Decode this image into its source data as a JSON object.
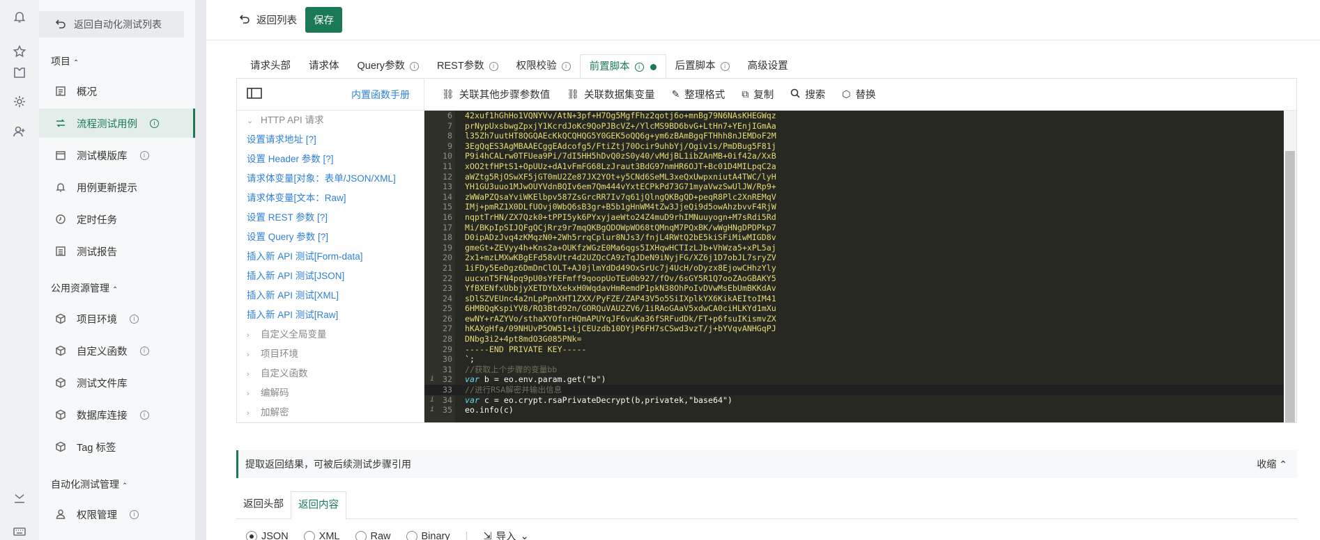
{
  "rail": {
    "icons": [
      "bell-icon",
      "star-icon",
      "shirt-icon",
      "gear-icon",
      "add-user-icon",
      "collapse-icon",
      "keyboard-icon"
    ]
  },
  "nav": {
    "back_label": "返回自动化测试列表",
    "group1": "项目",
    "group1_items": [
      {
        "label": "概况",
        "icon": "dashboard-icon",
        "info": false,
        "active": false
      },
      {
        "label": "流程测试用例",
        "icon": "flow-icon",
        "info": true,
        "active": true
      },
      {
        "label": "测试模版库",
        "icon": "template-icon",
        "info": true,
        "active": false
      },
      {
        "label": "用例更新提示",
        "icon": "bell-icon",
        "info": false,
        "active": false
      },
      {
        "label": "定时任务",
        "icon": "clock-icon",
        "info": false,
        "active": false
      },
      {
        "label": "测试报告",
        "icon": "report-icon",
        "info": false,
        "active": false
      }
    ],
    "group2": "公用资源管理",
    "group2_items": [
      {
        "label": "项目环境",
        "info": true
      },
      {
        "label": "自定义函数",
        "info": true
      },
      {
        "label": "测试文件库",
        "info": false
      },
      {
        "label": "数据库连接",
        "info": true
      },
      {
        "label": "Tag 标签",
        "info": false
      }
    ],
    "group3": "自动化测试管理",
    "group3_items": [
      {
        "label": "权限管理",
        "info": true
      }
    ]
  },
  "topbar": {
    "back_label": "返回列表",
    "save_label": "保存"
  },
  "tabs": [
    {
      "label": "请求头部",
      "info": false,
      "active": false
    },
    {
      "label": "请求体",
      "info": false,
      "active": false
    },
    {
      "label": "Query参数",
      "info": true,
      "active": false
    },
    {
      "label": "REST参数",
      "info": true,
      "active": false
    },
    {
      "label": "权限校验",
      "info": true,
      "active": false
    },
    {
      "label": "前置脚本",
      "info": true,
      "active": true,
      "dot": true
    },
    {
      "label": "后置脚本",
      "info": true,
      "active": false
    },
    {
      "label": "高级设置",
      "info": false,
      "active": false
    }
  ],
  "panel": {
    "manual_link": "内置函数手册"
  },
  "toolbar": [
    {
      "label": "关联其他步骤参数值",
      "icon": "link-icon"
    },
    {
      "label": "关联数据集变量",
      "icon": "link-icon"
    },
    {
      "label": "整理格式",
      "icon": "format-icon"
    },
    {
      "label": "复制",
      "icon": "copy-icon"
    },
    {
      "label": "搜索",
      "icon": "search-icon"
    },
    {
      "label": "替换",
      "icon": "replace-icon"
    }
  ],
  "tree": [
    {
      "label": "HTTP API 请求",
      "type": "group-open"
    },
    {
      "label": "设置请求地址 [?]",
      "type": "link"
    },
    {
      "label": "设置 Header 参数 [?]",
      "type": "link"
    },
    {
      "label": "请求体变量[对象：表单/JSON/XML]",
      "type": "link"
    },
    {
      "label": "请求体变量[文本：Raw]",
      "type": "link"
    },
    {
      "label": "设置 REST 参数 [?]",
      "type": "link"
    },
    {
      "label": "设置 Query 参数 [?]",
      "type": "link"
    },
    {
      "label": "插入新 API 测试[Form-data]",
      "type": "link"
    },
    {
      "label": "插入新 API 测试[JSON]",
      "type": "link"
    },
    {
      "label": "插入新 API 测试[XML]",
      "type": "link"
    },
    {
      "label": "插入新 API 测试[Raw]",
      "type": "link"
    },
    {
      "label": "自定义全局变量",
      "type": "group"
    },
    {
      "label": "项目环境",
      "type": "group"
    },
    {
      "label": "自定义函数",
      "type": "group"
    },
    {
      "label": "编解码",
      "type": "group"
    },
    {
      "label": "加解密",
      "type": "group"
    }
  ],
  "code_lines": [
    {
      "n": "6",
      "text": "42xuf1hGhHo1VQNYVv/AtN+3pf+H7Og5MgfFhz2qotj6o+mnBg79N6NAsKHEGWqz",
      "cls": ""
    },
    {
      "n": "7",
      "text": "prNypUxsbwgZpxjY1KcrdJoKc9QoPJBcVZ+/YlcMS9BD6bvG+LtHn7+YEnjIGmAa",
      "cls": ""
    },
    {
      "n": "8",
      "text": "l35Zh7uutHT8QGQAEcKkQCQHQG5Y0GEK5oQQ6g+ym6zBAmBgqFTHhh8nJEMDoF2M",
      "cls": ""
    },
    {
      "n": "9",
      "text": "3EgQqES3AgMBAAECggEAdcofg5/FtiZtj70Ocir9uhbYj/Ogiv1s/PmDBug5F81j",
      "cls": ""
    },
    {
      "n": "10",
      "text": "P9i4hCALrw0TFUea9Pi/7dI5HH5hDvQ0zS0y40/vMdjBL1ibZAnMB+0if42a/XxB",
      "cls": ""
    },
    {
      "n": "11",
      "text": "xOO2tfHPtS1+OpUUz+dA1vFmFG68LzJraut3BdG97nmHR6OJT+Bc01D4MILpqC2a",
      "cls": ""
    },
    {
      "n": "12",
      "text": "aWZtg5RjOSwXF5jGT0mU2Ze87JX2YOt+y5CNd6SeML3xeQxUwpxniutA4TWC/lyH",
      "cls": ""
    },
    {
      "n": "13",
      "text": "YH1GU3uuo1MJwOUYVdnBQIv6em7Qm444vYxtECPkPd73G71myaVwzSwUlJW/Rp9+",
      "cls": ""
    },
    {
      "n": "14",
      "text": "zWWaPZQsaYviWKElbpv587ZsGrcRR7Iv7q61jQlngQKBgQD+peqR8Plc2XnREMqV",
      "cls": ""
    },
    {
      "n": "15",
      "text": "IMj+pmRZ1X0DLfUOvj0WbQ6sB3gr+B5b1gHnWM4tZw3JjeQi9d5owAhzbvvF4RjW",
      "cls": ""
    },
    {
      "n": "16",
      "text": "nqptTrHN/ZX7Qzk0+tPPI5yk6PYxyjaeWto24Z4muD9rhIMNuuyogn+M7sRdi5Rd",
      "cls": ""
    },
    {
      "n": "17",
      "text": "Mi/BKpIpSIJQFgQCjRrz9r7mqQKBgQDOWpWO68tQMnqM7PQxBK/wWgHNgDPDPkp7",
      "cls": ""
    },
    {
      "n": "18",
      "text": "D0ipADzJvq4zKMqzN0+2Wh5rrqCplur8NJs3/fnjL4RWtQ2bE5kiSFiMiwMIGD8v",
      "cls": ""
    },
    {
      "n": "19",
      "text": "gmeGt+ZEVyy4h+Kns2a+OUKfzWGzE0Ma6qgs5IXHqwHCTIzLJb+VhWza5+xPL5aj",
      "cls": ""
    },
    {
      "n": "20",
      "text": "2x1+mzLMXwKBgEFd58vUtr4d2UZQcCA9zTqJDeN9iNyjFG/XZ6j1D7obJL7sryZV",
      "cls": ""
    },
    {
      "n": "21",
      "text": "1iFDy5EeDgz6DmDnClOLT+AJ0jlmYdDd49OxSrUc7j4UcH/oDyzx8EjowCHhzYly",
      "cls": ""
    },
    {
      "n": "22",
      "text": "uucxnT5FN4pq9pU0sYFEFmff9qoopUoTEu0b927/fOv/6sGY5R1Q7ooZAoGBAKY5",
      "cls": ""
    },
    {
      "n": "23",
      "text": "YfBXENfxUbbjyXETDYbXekxH0WqdavHmRemdP1pkN38OhPoIvDVwMsEbUmBKKdAv",
      "cls": ""
    },
    {
      "n": "24",
      "text": "sDlSZVEUnc4a2nLpPpnXHT1ZXX/PyFZE/ZAP43V5o5SiIXplkYX6KikAEItoIM41",
      "cls": ""
    },
    {
      "n": "25",
      "text": "6HMBQqKspiYV8/RQ3Btd92n/GORQuVAU2ZV6/1iRAoGAaV5xdwCA0ciHLKYd1mXu",
      "cls": ""
    },
    {
      "n": "26",
      "text": "ewNY+rAZYVo/sthaXYOfnrHQmAPUYqJF6vuKa36fSRFudDk/FT+p6fsuIKismvZX",
      "cls": ""
    },
    {
      "n": "27",
      "text": "hKAXgHfa/09NHUvP5OW51+ijCEUzdb10DYjP6FH7sCSwd3vzT/j+bYVqvANHGqPJ",
      "cls": ""
    },
    {
      "n": "28",
      "text": "DNbg3i2+4pt8mdO3G085PNk=",
      "cls": ""
    },
    {
      "n": "29",
      "text": "-----END PRIVATE KEY-----",
      "cls": ""
    },
    {
      "n": "30",
      "text": "`;",
      "cls": "plain"
    },
    {
      "n": "31",
      "text": "//获取上个步骤的变量bb",
      "cls": "comment"
    },
    {
      "n": "32",
      "text": "var b = eo.env.param.get(\"b\")",
      "cls": "plain",
      "mark": "i"
    },
    {
      "n": "33",
      "text": "//进行RSA解密并输出信息",
      "cls": "comment"
    },
    {
      "n": "34",
      "text": "var c = eo.crypt.rsaPrivateDecrypt(b,privatek,\"base64\")",
      "cls": "plain",
      "mark": "i"
    },
    {
      "n": "35",
      "text": "eo.info(c)",
      "cls": "plain",
      "mark": "i"
    }
  ],
  "extract": {
    "title": "提取返回结果，可被后续测试步骤引用",
    "collapse_label": "收缩"
  },
  "result_tabs": [
    {
      "label": "返回头部",
      "active": false
    },
    {
      "label": "返回内容",
      "active": true
    }
  ],
  "radios": [
    {
      "label": "JSON",
      "checked": true
    },
    {
      "label": "XML",
      "checked": false
    },
    {
      "label": "Raw",
      "checked": false
    },
    {
      "label": "Binary",
      "checked": false
    }
  ],
  "import_label": "导入"
}
